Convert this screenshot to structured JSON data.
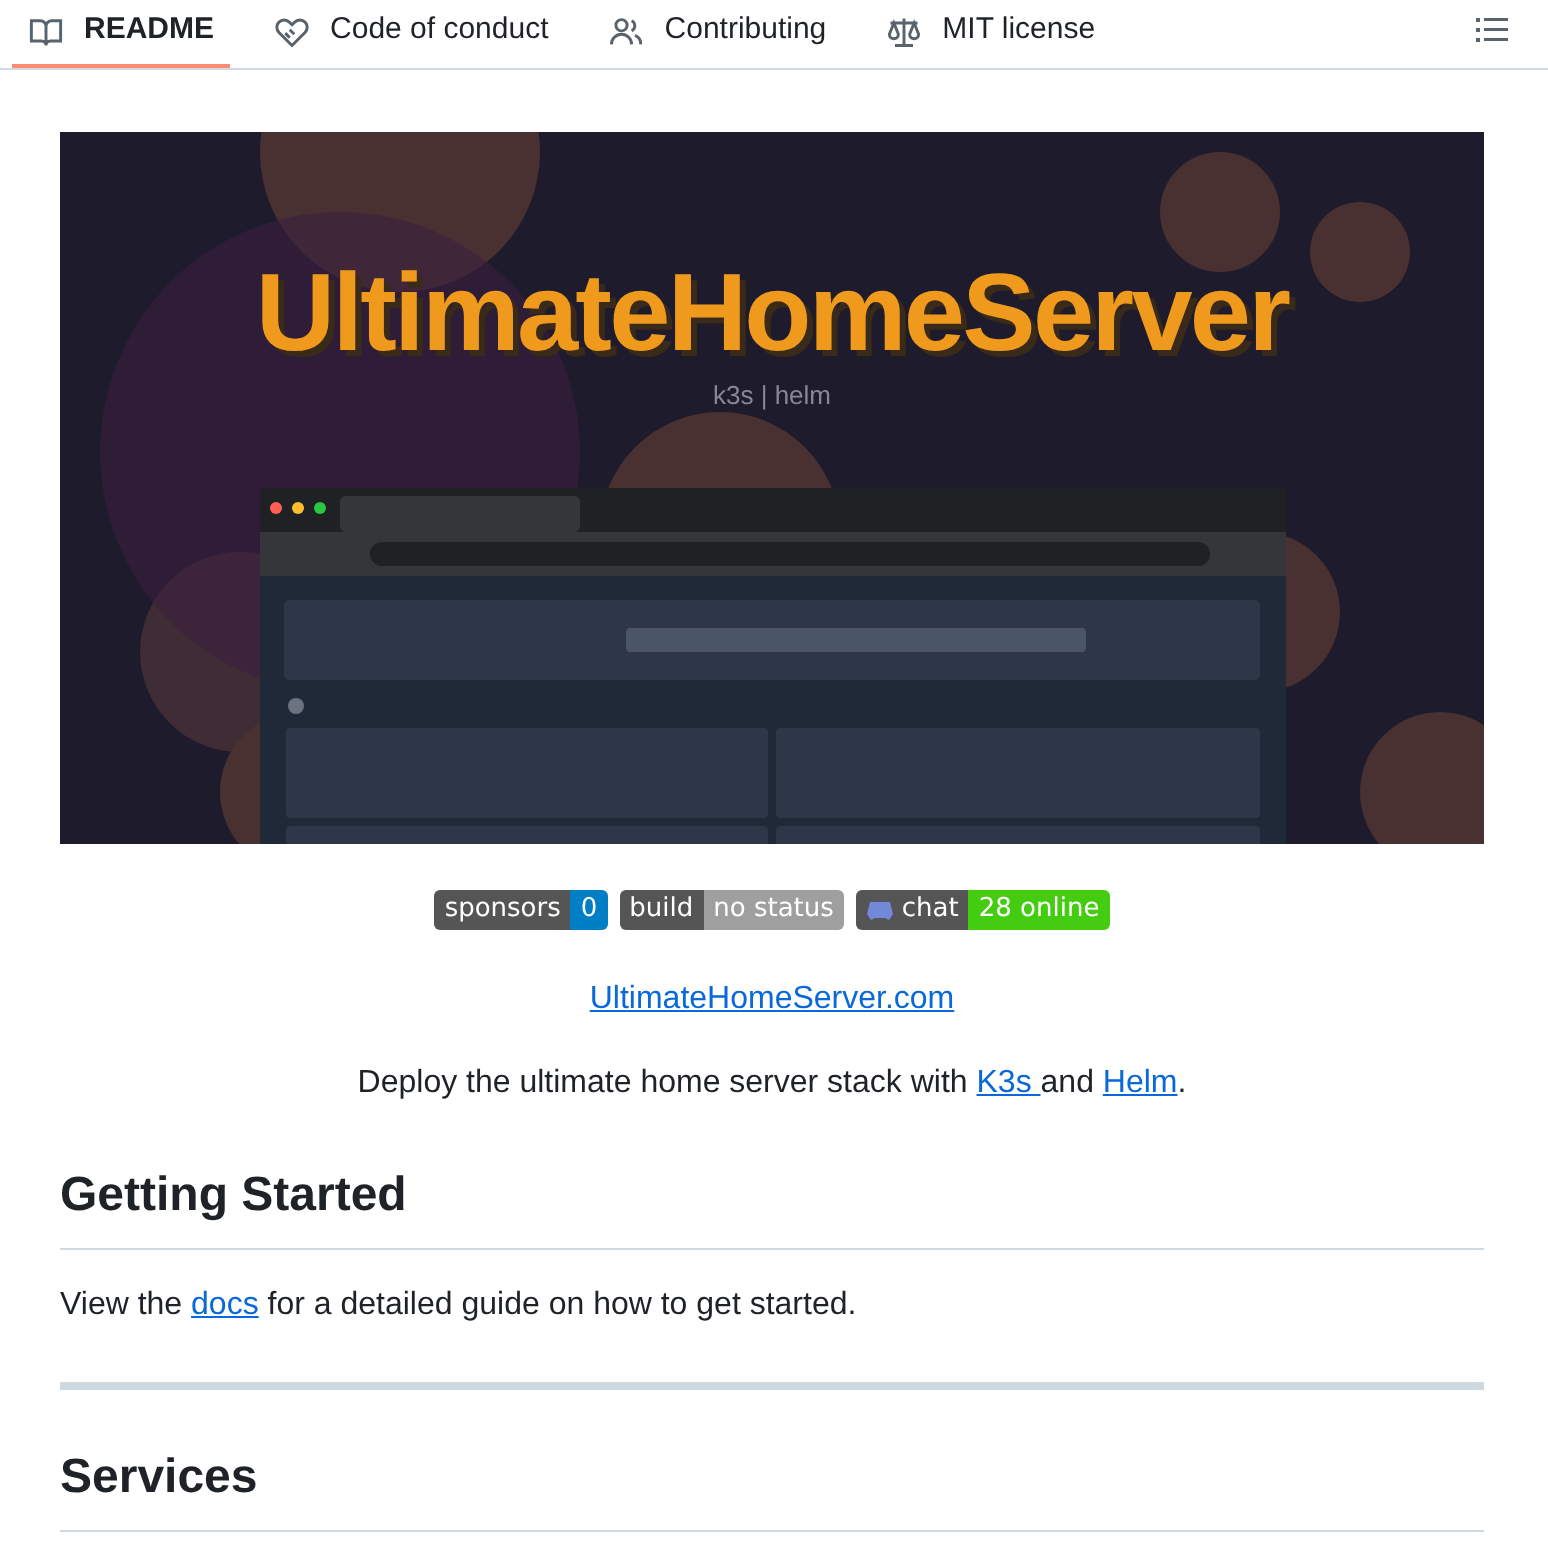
{
  "tabs": [
    {
      "label": "README",
      "kind": "book",
      "selected": true
    },
    {
      "label": "Code of conduct",
      "kind": "heart",
      "selected": false
    },
    {
      "label": "Contributing",
      "kind": "people",
      "selected": false
    },
    {
      "label": "MIT license",
      "kind": "scale",
      "selected": false
    }
  ],
  "banner": {
    "title": "UltimateHomeServer",
    "subtitle": "k3s | helm"
  },
  "badges": [
    {
      "label": "sponsors",
      "value": "0",
      "color": "#007ec6",
      "kind": "plain"
    },
    {
      "label": "build",
      "value": "no status",
      "color": "#9f9f9f",
      "kind": "plain"
    },
    {
      "label": "chat",
      "value": "28 online",
      "color": "#44cc11",
      "kind": "chat"
    }
  ],
  "site_link": "UltimateHomeServer.com",
  "intro": {
    "before": "Deploy the ultimate home server stack with ",
    "link1": "K3s ",
    "middle": "and ",
    "link2": "Helm",
    "after": "."
  },
  "sections": [
    {
      "heading": "Getting Started",
      "text_before": "View the ",
      "link": "docs",
      "text_after": " for a detailed guide on how to get started."
    },
    {
      "heading": "Services"
    }
  ]
}
